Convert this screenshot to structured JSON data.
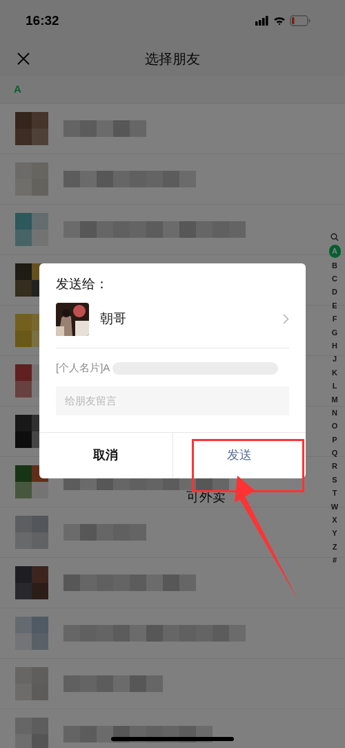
{
  "status_bar": {
    "time": "16:32"
  },
  "nav": {
    "title": "选择朋友"
  },
  "section": {
    "letter": "A"
  },
  "contacts": [
    {
      "kind": "redacted"
    },
    {
      "kind": "redacted"
    },
    {
      "kind": "redacted"
    },
    {
      "kind": "redacted"
    },
    {
      "kind": "redacted"
    },
    {
      "kind": "redacted"
    },
    {
      "kind": "redacted"
    },
    {
      "kind": "redacted",
      "name_fragment": "可外卖"
    },
    {
      "kind": "redacted"
    },
    {
      "kind": "redacted"
    },
    {
      "kind": "redacted"
    },
    {
      "kind": "redacted"
    },
    {
      "kind": "redacted"
    }
  ],
  "index_bar": [
    {
      "kind": "search",
      "selected": false
    },
    {
      "kind": "letter",
      "label": "A",
      "selected": true
    },
    {
      "kind": "letter",
      "label": "B",
      "selected": false
    },
    {
      "kind": "letter",
      "label": "C",
      "selected": false
    },
    {
      "kind": "letter",
      "label": "D",
      "selected": false
    },
    {
      "kind": "letter",
      "label": "E",
      "selected": false
    },
    {
      "kind": "letter",
      "label": "F",
      "selected": false
    },
    {
      "kind": "letter",
      "label": "G",
      "selected": false
    },
    {
      "kind": "letter",
      "label": "H",
      "selected": false
    },
    {
      "kind": "letter",
      "label": "J",
      "selected": false
    },
    {
      "kind": "letter",
      "label": "K",
      "selected": false
    },
    {
      "kind": "letter",
      "label": "L",
      "selected": false
    },
    {
      "kind": "letter",
      "label": "M",
      "selected": false
    },
    {
      "kind": "letter",
      "label": "N",
      "selected": false
    },
    {
      "kind": "letter",
      "label": "O",
      "selected": false
    },
    {
      "kind": "letter",
      "label": "P",
      "selected": false
    },
    {
      "kind": "letter",
      "label": "Q",
      "selected": false
    },
    {
      "kind": "letter",
      "label": "R",
      "selected": false
    },
    {
      "kind": "letter",
      "label": "S",
      "selected": false
    },
    {
      "kind": "letter",
      "label": "T",
      "selected": false
    },
    {
      "kind": "letter",
      "label": "W",
      "selected": false
    },
    {
      "kind": "letter",
      "label": "X",
      "selected": false
    },
    {
      "kind": "letter",
      "label": "Y",
      "selected": false
    },
    {
      "kind": "letter",
      "label": "Z",
      "selected": false
    },
    {
      "kind": "letter",
      "label": "#",
      "selected": false
    }
  ],
  "dialog": {
    "heading": "发送给：",
    "recipient": {
      "name": "朝哥"
    },
    "card_text": "[个人名片]A",
    "message": {
      "placeholder": "给朋友留言"
    },
    "buttons": [
      {
        "label": "取消",
        "kind": "cancel"
      },
      {
        "label": "发送",
        "kind": "primary"
      }
    ]
  }
}
